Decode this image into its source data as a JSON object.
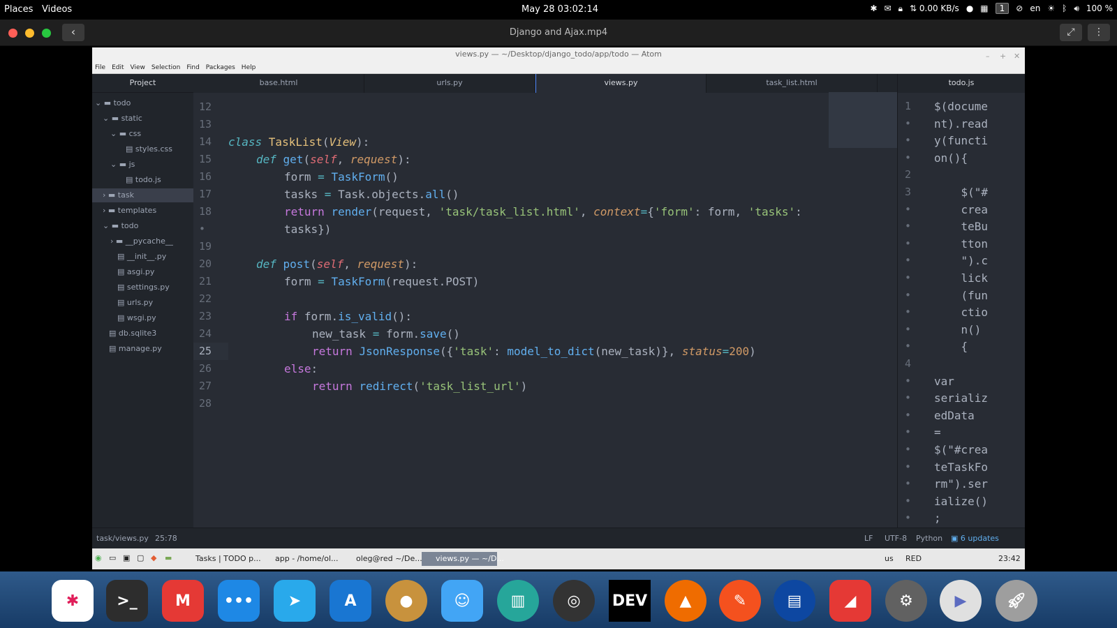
{
  "topbar": {
    "places": "Places",
    "videos": "Videos",
    "clock": "May 28  03:02:14",
    "net_speed": "⇅ 0.00 KB/s",
    "workspace": "1",
    "lang": "en",
    "battery": "100 %"
  },
  "player": {
    "title": "Django and Ajax.mp4"
  },
  "atom": {
    "window_title": "views.py — ~/Desktop/django_todo/app/todo — Atom",
    "menu": [
      "File",
      "Edit",
      "View",
      "Selection",
      "Find",
      "Packages",
      "Help"
    ],
    "project_header": "Project",
    "tree": [
      {
        "label": "todo",
        "type": "folder-open"
      },
      {
        "label": "static",
        "type": "folder-open"
      },
      {
        "label": "css",
        "type": "folder-open"
      },
      {
        "label": "styles.css",
        "type": "file"
      },
      {
        "label": "js",
        "type": "folder-open"
      },
      {
        "label": "todo.js",
        "type": "file"
      },
      {
        "label": "task",
        "type": "folder-closed"
      },
      {
        "label": "templates",
        "type": "folder-closed"
      },
      {
        "label": "todo",
        "type": "folder-open"
      },
      {
        "label": "__pycache__",
        "type": "folder-closed"
      },
      {
        "label": "__init__.py",
        "type": "file"
      },
      {
        "label": "asgi.py",
        "type": "file"
      },
      {
        "label": "settings.py",
        "type": "file"
      },
      {
        "label": "urls.py",
        "type": "file"
      },
      {
        "label": "wsgi.py",
        "type": "file"
      },
      {
        "label": "db.sqlite3",
        "type": "file"
      },
      {
        "label": "manage.py",
        "type": "file"
      }
    ],
    "tabs": [
      "base.html",
      "urls.py",
      "views.py",
      "task_list.html"
    ],
    "active_tab": "views.py",
    "line_numbers": [
      "12",
      "13",
      "14",
      "15",
      "16",
      "17",
      "18",
      "•",
      "19",
      "20",
      "21",
      "22",
      "23",
      "24",
      "25",
      "26",
      "27",
      "28"
    ],
    "right_tab": "todo.js",
    "right_line_numbers": [
      "1",
      "•",
      "•",
      "•",
      "2",
      "3",
      "•",
      "•",
      "•",
      "•",
      "•",
      "•",
      "•",
      "•",
      "•",
      "4",
      "•",
      "•",
      "•",
      "•",
      "•",
      "•",
      "•",
      "•",
      "•"
    ],
    "right_code": [
      "$(docume",
      "nt).read",
      "y(functi",
      "on(){",
      "",
      "    $(\"#",
      "    crea",
      "    teBu",
      "    tton",
      "    \").c",
      "    lick",
      "    (fun",
      "    ctio",
      "    n()",
      "    {",
      "",
      "var",
      "serializ",
      "edData",
      "=",
      "$(\"#crea",
      "teTaskFo",
      "rm\").ser",
      "ialize()",
      ";"
    ],
    "status": {
      "path": "task/views.py",
      "cursor": "25:78",
      "line_ending": "LF",
      "encoding": "UTF-8",
      "grammar": "Python",
      "updates": "6 updates"
    }
  },
  "panel": {
    "tasks": [
      "Tasks | TODO p...",
      "app - /home/ol...",
      "oleg@red ~/De...",
      "views.py — ~/D..."
    ],
    "tray": "us",
    "user": "RED",
    "time": "23:42"
  },
  "dock": {
    "apps": [
      "Slack",
      "Terminal",
      "Gmail",
      "Messages",
      "Telegram",
      "App Store",
      "Contacts",
      "Finder",
      "Charts",
      "Audio",
      "DEV",
      "VLC",
      "Sketch",
      "Files",
      "Slides",
      "Settings",
      "Media",
      "Launcher"
    ]
  }
}
